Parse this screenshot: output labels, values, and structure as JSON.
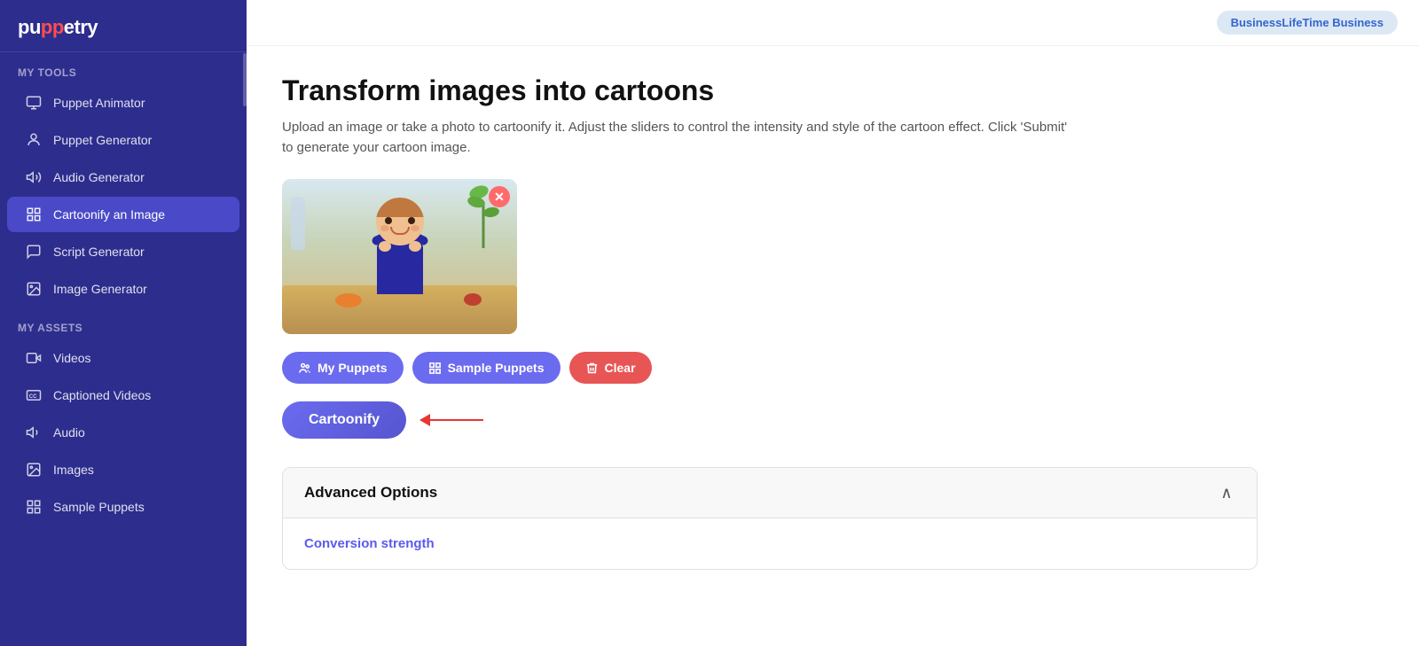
{
  "logo": {
    "text_before": "pu",
    "eyes": "pp",
    "text_after": "etry"
  },
  "header": {
    "plan_badge": "BusinessLifeTime Business"
  },
  "sidebar": {
    "my_tools_label": "My Tools",
    "my_assets_label": "My Assets",
    "tools": [
      {
        "id": "puppet-animator",
        "label": "Puppet Animator",
        "icon": "monitor-icon"
      },
      {
        "id": "puppet-generator",
        "label": "Puppet Generator",
        "icon": "person-icon"
      },
      {
        "id": "audio-generator",
        "label": "Audio Generator",
        "icon": "audio-icon"
      },
      {
        "id": "cartoonify-an-image",
        "label": "Cartoonify an Image",
        "icon": "grid-icon",
        "active": true
      },
      {
        "id": "script-generator",
        "label": "Script Generator",
        "icon": "message-icon"
      },
      {
        "id": "image-generator",
        "label": "Image Generator",
        "icon": "image-icon"
      }
    ],
    "assets": [
      {
        "id": "videos",
        "label": "Videos",
        "icon": "video-icon"
      },
      {
        "id": "captioned-videos",
        "label": "Captioned Videos",
        "icon": "cc-icon"
      },
      {
        "id": "audio",
        "label": "Audio",
        "icon": "audio2-icon"
      },
      {
        "id": "images",
        "label": "Images",
        "icon": "image2-icon"
      },
      {
        "id": "sample-puppets",
        "label": "Sample Puppets",
        "icon": "grid2-icon"
      }
    ]
  },
  "main": {
    "title": "Transform images into cartoons",
    "description": "Upload an image or take a photo to cartoonify it. Adjust the sliders to control the intensity and style of the cartoon effect. Click 'Submit' to generate your cartoon image.",
    "buttons": {
      "my_puppets": "My Puppets",
      "sample_puppets": "Sample Puppets",
      "clear": "Clear",
      "cartoonify": "Cartoonify"
    },
    "advanced_options": {
      "title": "Advanced Options",
      "conversion_strength_label": "Conversion strength"
    }
  }
}
